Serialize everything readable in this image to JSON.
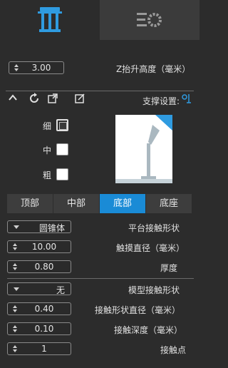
{
  "tabs": {
    "support_icon": "support-pillars-icon",
    "settings_icon": "gear-list-icon"
  },
  "lift": {
    "label": "Z抬升高度（毫米）",
    "value": "3.00"
  },
  "support_settings": {
    "label": "支撑设置:"
  },
  "sizes": [
    {
      "label": "细",
      "checked": true
    },
    {
      "label": "中",
      "checked": false
    },
    {
      "label": "粗",
      "checked": false
    }
  ],
  "segments": [
    {
      "label": "顶部",
      "active": false
    },
    {
      "label": "中部",
      "active": false
    },
    {
      "label": "底部",
      "active": true
    },
    {
      "label": "底座",
      "active": false
    }
  ],
  "params": {
    "platform_shape": {
      "label": "平台接触形状",
      "value": "圆锥体"
    },
    "contact_diameter": {
      "label": "触摸直径（毫米）",
      "value": "10.00"
    },
    "thickness": {
      "label": "厚度",
      "value": "0.80"
    },
    "model_contact_shape": {
      "label": "模型接触形状",
      "value": "无"
    },
    "contact_shape_diameter": {
      "label": "接触形状直径（毫米）",
      "value": "0.40"
    },
    "contact_depth": {
      "label": "接触深度（毫米）",
      "value": "0.10"
    },
    "contact_points": {
      "label": "接触点",
      "value": "1"
    }
  },
  "colors": {
    "accent": "#1a8bd6",
    "bg": "#2c2c2c"
  }
}
